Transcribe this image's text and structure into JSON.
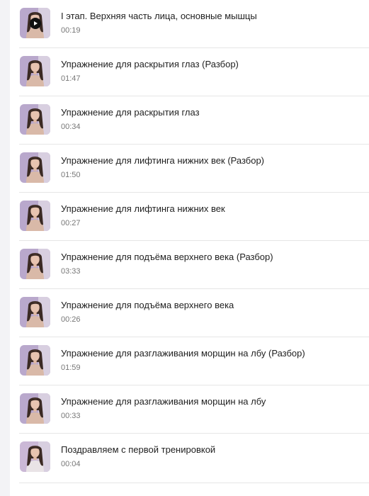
{
  "lessons": [
    {
      "title": "I этап. Верхняя часть лица, основные мышцы",
      "duration": "00:19",
      "playing": true
    },
    {
      "title": "Упражнение для раскрытия глаз (Разбор)",
      "duration": "01:47"
    },
    {
      "title": "Упражнение для раскрытия глаз",
      "duration": "00:34"
    },
    {
      "title": "Упражнение для лифтинга нижних век (Разбор)",
      "duration": "01:50"
    },
    {
      "title": "Упражнение для лифтинга нижних век",
      "duration": "00:27"
    },
    {
      "title": "Упражнение для подъёма верхнего века (Разбор)",
      "duration": "03:33"
    },
    {
      "title": "Упражнение для подъёма верхнего века",
      "duration": "00:26"
    },
    {
      "title": "Упражнение для разглаживания морщин на лбу (Разбор)",
      "duration": "01:59"
    },
    {
      "title": "Упражнение для разглаживания морщин на лбу",
      "duration": "00:33"
    },
    {
      "title": "Поздравляем с первой тренировкой",
      "duration": "00:04"
    }
  ],
  "icons": {
    "play": "play-icon"
  },
  "colors": {
    "divider": "#e6e6e6",
    "title": "#1f1f1f",
    "duration": "#777777"
  }
}
